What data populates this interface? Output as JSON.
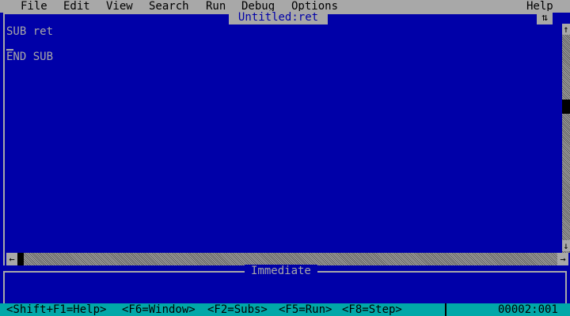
{
  "menu": {
    "items": [
      {
        "label": "File"
      },
      {
        "label": "Edit"
      },
      {
        "label": "View"
      },
      {
        "label": "Search"
      },
      {
        "label": "Run"
      },
      {
        "label": "Debug"
      },
      {
        "label": "Options"
      }
    ],
    "help": "Help"
  },
  "editor": {
    "title": "Untitled:ret",
    "lines": [
      "SUB ret",
      "END SUB"
    ]
  },
  "immediate": {
    "title": "Immediate"
  },
  "status": {
    "hints": [
      "<Shift+F1=Help>",
      "<F6=Window>",
      "<F2=Subs>",
      "<F5=Run>",
      "<F8=Step>"
    ],
    "position": "00002:001"
  },
  "colors": {
    "background": "#0000a8",
    "foreground": "#a8a8a8",
    "menu": "#a8a8a8",
    "status": "#00a8a8"
  },
  "icons": {
    "maximize": "maximize-arrows-icon",
    "scroll_up": "arrow-up-icon",
    "scroll_down": "arrow-down-icon",
    "scroll_left": "arrow-left-icon",
    "scroll_right": "arrow-right-icon"
  }
}
